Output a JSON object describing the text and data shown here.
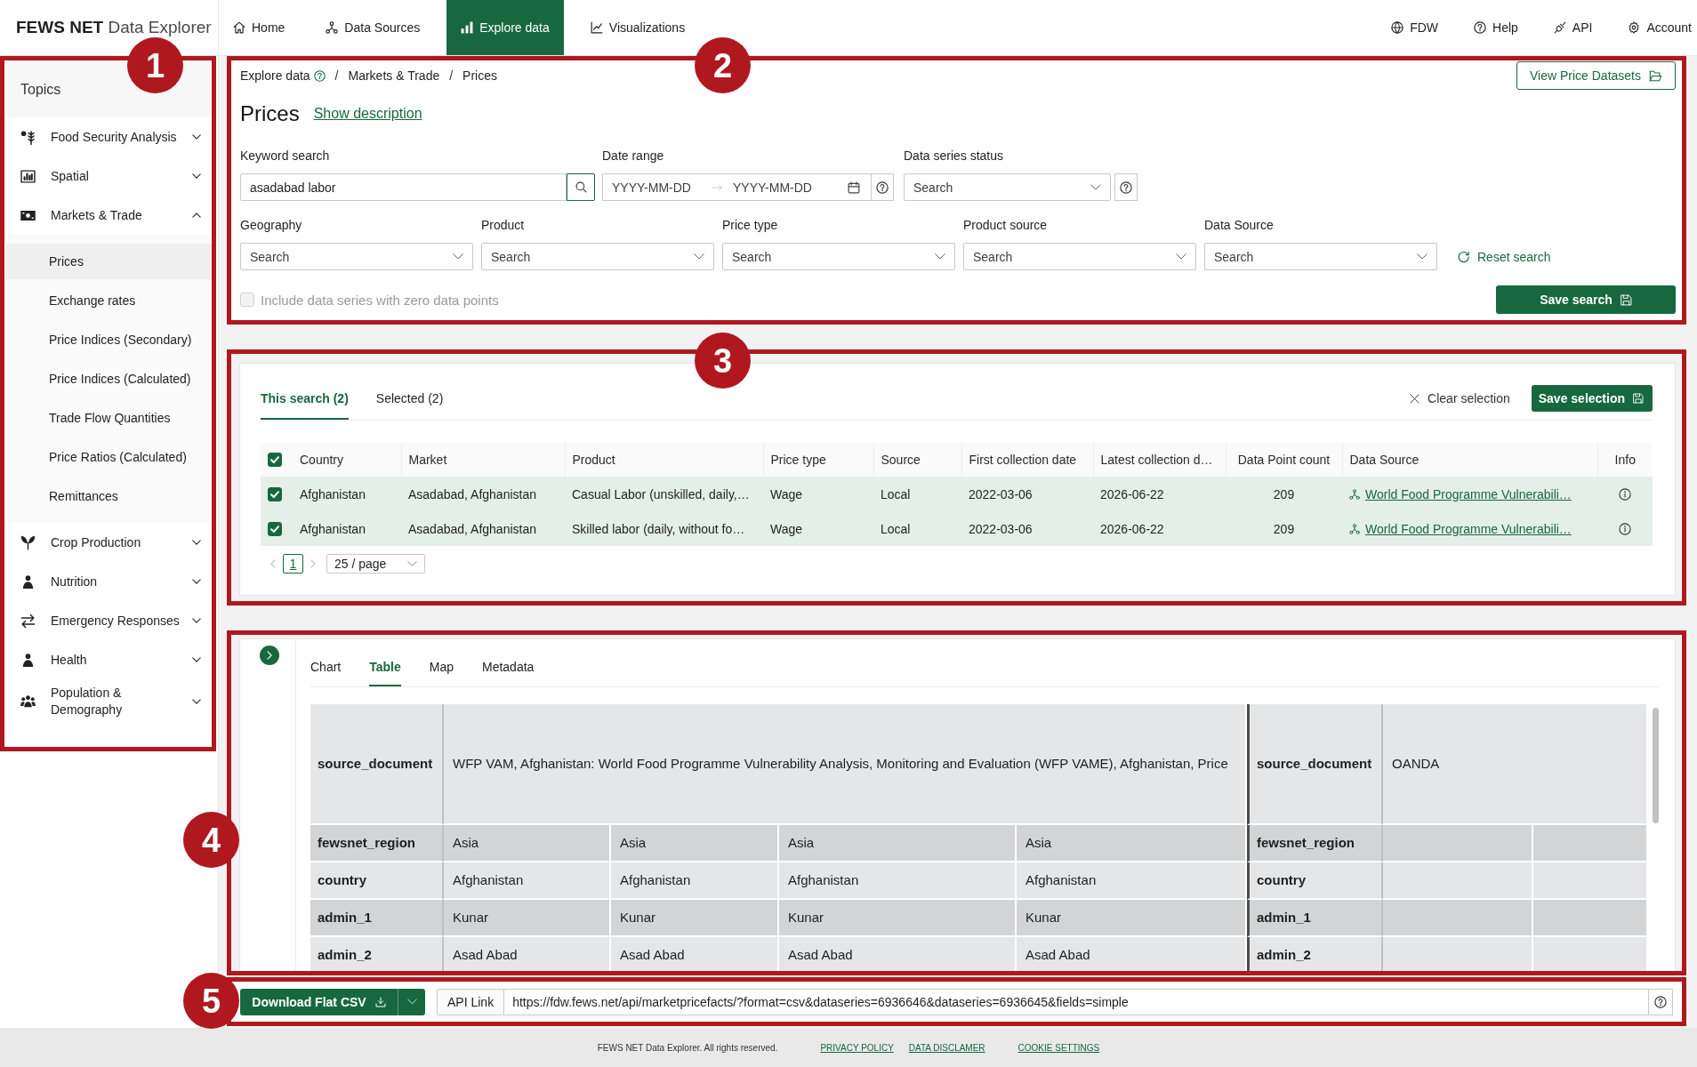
{
  "nav": {
    "brand": "**FEWS NET** Data Explorer",
    "items": [
      {
        "label": "Home",
        "selected": false
      },
      {
        "label": "Data Sources",
        "selected": false
      },
      {
        "label": "Explore data",
        "selected": true
      },
      {
        "label": "Visualizations",
        "selected": false
      }
    ],
    "right_items": [
      {
        "label": "FDW"
      },
      {
        "label": "Help"
      },
      {
        "label": "API"
      },
      {
        "label": "Account"
      }
    ]
  },
  "sidebar": {
    "callout": "1",
    "title": "Topics",
    "items": [
      {
        "label": "Food Security Analysis",
        "expanded": false
      },
      {
        "label": "Spatial",
        "expanded": false
      },
      {
        "label": "Markets & Trade",
        "expanded": true,
        "children": [
          {
            "label": "Prices",
            "selected": true
          },
          {
            "label": "Exchange rates",
            "selected": false
          },
          {
            "label": "Price Indices (Secondary)",
            "selected": false
          },
          {
            "label": "Price Indices (Calculated)",
            "selected": false
          },
          {
            "label": "Trade Flow Quantities",
            "selected": false
          },
          {
            "label": "Price Ratios (Calculated)",
            "selected": false
          },
          {
            "label": "Remittances",
            "selected": false
          }
        ]
      },
      {
        "label": "Crop Production",
        "expanded": false
      },
      {
        "label": "Nutrition",
        "expanded": false
      },
      {
        "label": "Emergency Responses",
        "expanded": false
      },
      {
        "label": "Health",
        "expanded": false
      },
      {
        "label": "Population & Demography",
        "expanded": false
      }
    ]
  },
  "search_panel": {
    "callout": "2",
    "breadcrumb": [
      {
        "label": "Explore data",
        "separator": "/"
      },
      {
        "label": "Markets & Trade",
        "separator": "/"
      },
      {
        "label": "Prices"
      }
    ],
    "view_button": "View Price Datasets",
    "title": "Prices",
    "description_link": "Show description",
    "keyword": {
      "label": "Keyword search",
      "value": "asadabad labor"
    },
    "date_range": {
      "label": "Date range",
      "start_placeholder": "YYYY-MM-DD",
      "end_placeholder": "YYYY-MM-DD"
    },
    "status": {
      "label": "Data series status",
      "placeholder": "Search"
    },
    "filters": [
      {
        "label": "Geography",
        "placeholder": "Search"
      },
      {
        "label": "Product",
        "placeholder": "Search"
      },
      {
        "label": "Price type",
        "placeholder": "Search"
      },
      {
        "label": "Product source",
        "placeholder": "Search"
      },
      {
        "label": "Data Source",
        "placeholder": "Search"
      }
    ],
    "reset_link": "Reset search",
    "zero_points": {
      "label": "Include data series with zero data points",
      "checked": false,
      "disabled": true
    },
    "save_button": "Save search"
  },
  "results_panel": {
    "callout": "3",
    "tabs": [
      {
        "label": "This search (2)",
        "selected": true
      },
      {
        "label": "Selected (2)",
        "selected": false
      }
    ],
    "clear_button": "Clear selection",
    "save_button": "Save selection",
    "table": {
      "select_all": {
        "checked": true
      },
      "columns": [
        "Country",
        "Market",
        "Product",
        "Price type",
        "Source",
        "First collection date",
        "Latest collection d…",
        "Data Point count",
        "Data Source",
        "Info"
      ],
      "rows": [
        {
          "checked": true,
          "cells": [
            "Afghanistan",
            "Asadabad, Afghanistan",
            "Casual Labor (unskilled, daily,…",
            "Wage",
            "Local",
            "2022-03-06",
            "2026-06-22",
            "209"
          ],
          "data_source": "World Food Programme Vulnerabili…"
        },
        {
          "checked": true,
          "cells": [
            "Afghanistan",
            "Asadabad, Afghanistan",
            "Skilled labor (daily, without fo…",
            "Wage",
            "Local",
            "2022-03-06",
            "2026-06-22",
            "209"
          ],
          "data_source": "World Food Programme Vulnerabili…"
        }
      ]
    },
    "pagination": {
      "pages": [
        {
          "label": "1",
          "selected": true
        }
      ],
      "page_size": "25 / page"
    }
  },
  "detail_panel": {
    "callout": "4",
    "tabs": [
      {
        "label": "Chart",
        "selected": false
      },
      {
        "label": "Table",
        "selected": true
      },
      {
        "label": "Map",
        "selected": false
      },
      {
        "label": "Metadata",
        "selected": false
      }
    ],
    "series": [
      {
        "rows": [
          {
            "field": "source_document",
            "values": [
              "WFP VAM, Afghanistan: World Food Programme Vulnerability Analysis, Monitoring and Evaluation (WFP VAME), Afghanistan, Price"
            ]
          },
          {
            "field": "fewsnet_region",
            "values": [
              "Asia",
              "Asia",
              "Asia",
              "Asia"
            ]
          },
          {
            "field": "country",
            "values": [
              "Afghanistan",
              "Afghanistan",
              "Afghanistan",
              "Afghanistan"
            ]
          },
          {
            "field": "admin_1",
            "values": [
              "Kunar",
              "Kunar",
              "Kunar",
              "Kunar"
            ]
          },
          {
            "field": "admin_2",
            "values": [
              "Asad Abad",
              "Asad Abad",
              "Asad Abad",
              "Asad Abad"
            ]
          }
        ]
      },
      {
        "rows": [
          {
            "field": "source_document",
            "values": [
              "OANDA"
            ]
          },
          {
            "field": "fewsnet_region"
          },
          {
            "field": "country"
          },
          {
            "field": "admin_1"
          },
          {
            "field": "admin_2"
          }
        ]
      }
    ]
  },
  "export_bar": {
    "callout": "5",
    "download_button": "Download Flat CSV",
    "api_label": "API Link",
    "api_url": "https://fdw.fews.net/api/marketpricefacts/?format=csv&dataseries=6936646&dataseries=6936645&fields=simple"
  },
  "footer": {
    "text": "FEWS NET Data Explorer. All rights reserved.",
    "links": [
      "PRIVACY POLICY",
      "DATA DISCLAMER",
      "COOKIE SETTINGS"
    ]
  }
}
